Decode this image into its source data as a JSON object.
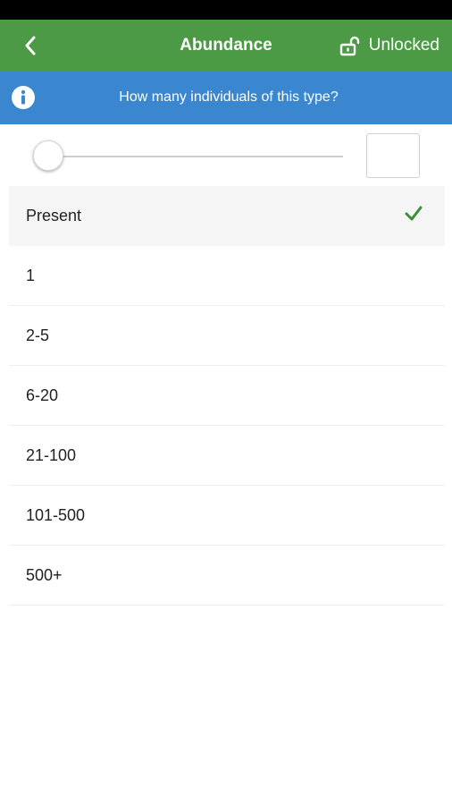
{
  "header": {
    "title": "Abundance",
    "back_icon": "chevron-left-icon",
    "lock_label": "Unlocked",
    "lock_icon": "unlocked-padlock-icon",
    "background_color": "#4c9a45"
  },
  "info": {
    "text": "How many individuals of this type?",
    "icon": "info-icon",
    "background_color": "#3a87d0"
  },
  "slider": {
    "value_fraction": 0.0,
    "input_value": ""
  },
  "options": [
    {
      "label": "Present",
      "selected": true
    },
    {
      "label": "1",
      "selected": false
    },
    {
      "label": "2-5",
      "selected": false
    },
    {
      "label": "6-20",
      "selected": false
    },
    {
      "label": "21-100",
      "selected": false
    },
    {
      "label": "101-500",
      "selected": false
    },
    {
      "label": "500+",
      "selected": false
    }
  ],
  "check_color": "#3a8f37"
}
